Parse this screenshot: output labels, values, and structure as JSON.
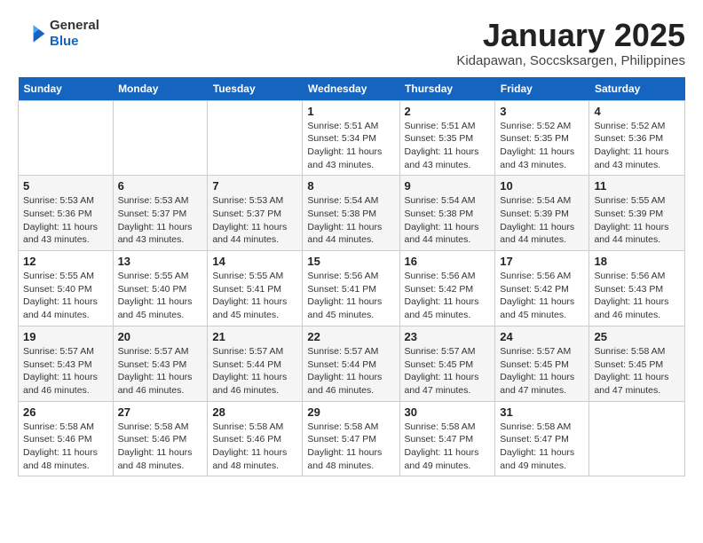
{
  "logo": {
    "general": "General",
    "blue": "Blue"
  },
  "title": "January 2025",
  "location": "Kidapawan, Soccsksargen, Philippines",
  "days_of_week": [
    "Sunday",
    "Monday",
    "Tuesday",
    "Wednesday",
    "Thursday",
    "Friday",
    "Saturday"
  ],
  "weeks": [
    [
      {
        "num": "",
        "info": ""
      },
      {
        "num": "",
        "info": ""
      },
      {
        "num": "",
        "info": ""
      },
      {
        "num": "1",
        "info": "Sunrise: 5:51 AM\nSunset: 5:34 PM\nDaylight: 11 hours and 43 minutes."
      },
      {
        "num": "2",
        "info": "Sunrise: 5:51 AM\nSunset: 5:35 PM\nDaylight: 11 hours and 43 minutes."
      },
      {
        "num": "3",
        "info": "Sunrise: 5:52 AM\nSunset: 5:35 PM\nDaylight: 11 hours and 43 minutes."
      },
      {
        "num": "4",
        "info": "Sunrise: 5:52 AM\nSunset: 5:36 PM\nDaylight: 11 hours and 43 minutes."
      }
    ],
    [
      {
        "num": "5",
        "info": "Sunrise: 5:53 AM\nSunset: 5:36 PM\nDaylight: 11 hours and 43 minutes."
      },
      {
        "num": "6",
        "info": "Sunrise: 5:53 AM\nSunset: 5:37 PM\nDaylight: 11 hours and 43 minutes."
      },
      {
        "num": "7",
        "info": "Sunrise: 5:53 AM\nSunset: 5:37 PM\nDaylight: 11 hours and 44 minutes."
      },
      {
        "num": "8",
        "info": "Sunrise: 5:54 AM\nSunset: 5:38 PM\nDaylight: 11 hours and 44 minutes."
      },
      {
        "num": "9",
        "info": "Sunrise: 5:54 AM\nSunset: 5:38 PM\nDaylight: 11 hours and 44 minutes."
      },
      {
        "num": "10",
        "info": "Sunrise: 5:54 AM\nSunset: 5:39 PM\nDaylight: 11 hours and 44 minutes."
      },
      {
        "num": "11",
        "info": "Sunrise: 5:55 AM\nSunset: 5:39 PM\nDaylight: 11 hours and 44 minutes."
      }
    ],
    [
      {
        "num": "12",
        "info": "Sunrise: 5:55 AM\nSunset: 5:40 PM\nDaylight: 11 hours and 44 minutes."
      },
      {
        "num": "13",
        "info": "Sunrise: 5:55 AM\nSunset: 5:40 PM\nDaylight: 11 hours and 45 minutes."
      },
      {
        "num": "14",
        "info": "Sunrise: 5:55 AM\nSunset: 5:41 PM\nDaylight: 11 hours and 45 minutes."
      },
      {
        "num": "15",
        "info": "Sunrise: 5:56 AM\nSunset: 5:41 PM\nDaylight: 11 hours and 45 minutes."
      },
      {
        "num": "16",
        "info": "Sunrise: 5:56 AM\nSunset: 5:42 PM\nDaylight: 11 hours and 45 minutes."
      },
      {
        "num": "17",
        "info": "Sunrise: 5:56 AM\nSunset: 5:42 PM\nDaylight: 11 hours and 45 minutes."
      },
      {
        "num": "18",
        "info": "Sunrise: 5:56 AM\nSunset: 5:43 PM\nDaylight: 11 hours and 46 minutes."
      }
    ],
    [
      {
        "num": "19",
        "info": "Sunrise: 5:57 AM\nSunset: 5:43 PM\nDaylight: 11 hours and 46 minutes."
      },
      {
        "num": "20",
        "info": "Sunrise: 5:57 AM\nSunset: 5:43 PM\nDaylight: 11 hours and 46 minutes."
      },
      {
        "num": "21",
        "info": "Sunrise: 5:57 AM\nSunset: 5:44 PM\nDaylight: 11 hours and 46 minutes."
      },
      {
        "num": "22",
        "info": "Sunrise: 5:57 AM\nSunset: 5:44 PM\nDaylight: 11 hours and 46 minutes."
      },
      {
        "num": "23",
        "info": "Sunrise: 5:57 AM\nSunset: 5:45 PM\nDaylight: 11 hours and 47 minutes."
      },
      {
        "num": "24",
        "info": "Sunrise: 5:57 AM\nSunset: 5:45 PM\nDaylight: 11 hours and 47 minutes."
      },
      {
        "num": "25",
        "info": "Sunrise: 5:58 AM\nSunset: 5:45 PM\nDaylight: 11 hours and 47 minutes."
      }
    ],
    [
      {
        "num": "26",
        "info": "Sunrise: 5:58 AM\nSunset: 5:46 PM\nDaylight: 11 hours and 48 minutes."
      },
      {
        "num": "27",
        "info": "Sunrise: 5:58 AM\nSunset: 5:46 PM\nDaylight: 11 hours and 48 minutes."
      },
      {
        "num": "28",
        "info": "Sunrise: 5:58 AM\nSunset: 5:46 PM\nDaylight: 11 hours and 48 minutes."
      },
      {
        "num": "29",
        "info": "Sunrise: 5:58 AM\nSunset: 5:47 PM\nDaylight: 11 hours and 48 minutes."
      },
      {
        "num": "30",
        "info": "Sunrise: 5:58 AM\nSunset: 5:47 PM\nDaylight: 11 hours and 49 minutes."
      },
      {
        "num": "31",
        "info": "Sunrise: 5:58 AM\nSunset: 5:47 PM\nDaylight: 11 hours and 49 minutes."
      },
      {
        "num": "",
        "info": ""
      }
    ]
  ]
}
